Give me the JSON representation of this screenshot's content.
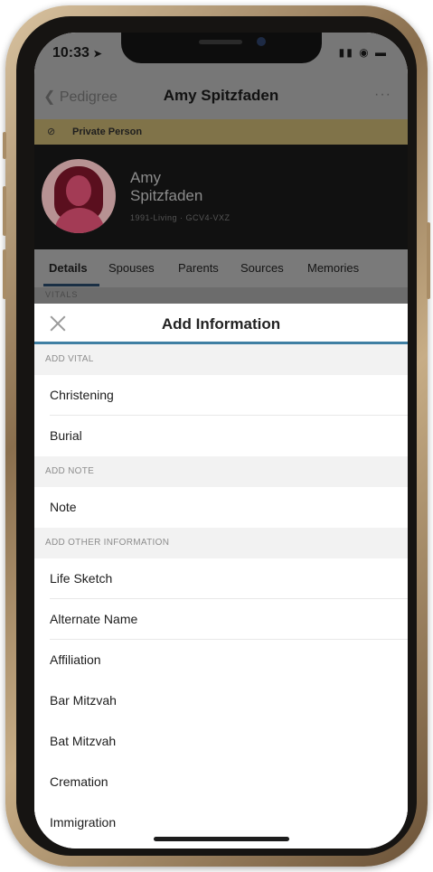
{
  "status": {
    "time": "10:33"
  },
  "nav": {
    "back_label": "Pedigree",
    "title": "Amy Spitzfaden",
    "more": "···"
  },
  "banner": {
    "text": "Private Person"
  },
  "person": {
    "first_name": "Amy",
    "last_name": "Spitzfaden",
    "meta": "1991-Living · GCV4-VXZ"
  },
  "tabs": [
    "Details",
    "Spouses",
    "Parents",
    "Sources",
    "Memories"
  ],
  "vitals_label": "VITALS",
  "sheet": {
    "title": "Add Information",
    "sections": [
      {
        "header": "ADD VITAL",
        "items": [
          "Christening",
          "Burial"
        ]
      },
      {
        "header": "ADD NOTE",
        "items": [
          "Note"
        ]
      },
      {
        "header": "ADD OTHER INFORMATION",
        "items": [
          "Life Sketch",
          "Alternate Name",
          "Affiliation",
          "Bar Mitzvah",
          "Bat Mitzvah",
          "Cremation",
          "Immigration"
        ]
      }
    ]
  },
  "colors": {
    "accent": "#3f7fa3",
    "banner": "#807349",
    "avatar_bg": "#b79293"
  }
}
